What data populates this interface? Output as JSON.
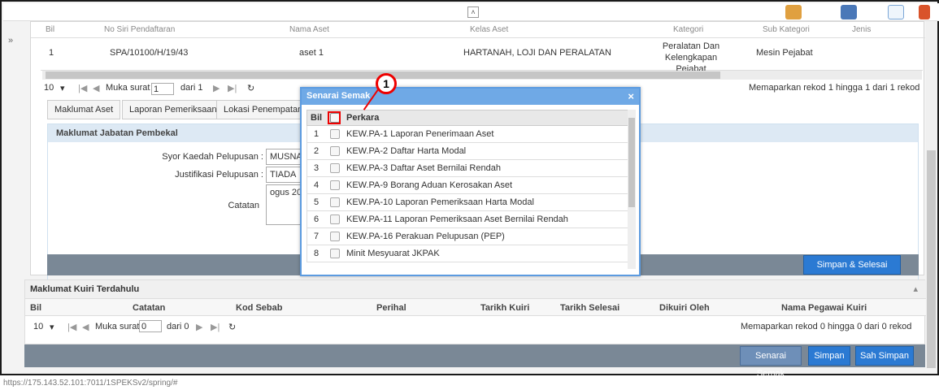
{
  "asset_table": {
    "headers": [
      "Bil",
      "No Siri Pendaftaran",
      "Nama Aset",
      "Kelas Aset",
      "Kategori",
      "Sub Kategori",
      "Jenis"
    ],
    "row": {
      "bil": "1",
      "no_siri": "SPA/10100/H/19/43",
      "nama": "aset 1",
      "kelas": "HARTANAH, LOJI DAN PERALATAN",
      "kategori": "Peralatan Dan Kelengkapan Pejabat",
      "sub_kategori": "Mesin Pejabat"
    }
  },
  "pager_top": {
    "size": "10",
    "muka_surat_label": "Muka surat",
    "page": "1",
    "dari_label": "dari 1",
    "summary": "Memaparkan rekod 1 hingga 1 dari 1 rekod"
  },
  "tabs": [
    "Maklumat Aset",
    "Laporan Pemeriksaan",
    "Lokasi Penempatan"
  ],
  "jabatan": {
    "header": "Maklumat Jabatan Pembekal",
    "syor_label": "Syor Kaedah Pelupusan :",
    "syor_value": "MUSNA",
    "justifikasi_label": "Justifikasi Pelupusan :",
    "justifikasi_value": "TIADA",
    "catatan_label": "Catatan",
    "catatan_value": "ogus 20",
    "save_button": "Simpan & Selesai"
  },
  "modal": {
    "title": "Senarai Semak",
    "col_bil": "Bil",
    "col_perkara": "Perkara",
    "rows": [
      {
        "bil": "1",
        "perkara": "KEW.PA-1 Laporan Penerimaan Aset"
      },
      {
        "bil": "2",
        "perkara": "KEW.PA-2 Daftar Harta Modal"
      },
      {
        "bil": "3",
        "perkara": "KEW.PA-3 Daftar Aset Bernilai Rendah"
      },
      {
        "bil": "4",
        "perkara": "KEW.PA-9 Borang Aduan Kerosakan Aset"
      },
      {
        "bil": "5",
        "perkara": "KEW.PA-10 Laporan Pemeriksaan Harta Modal"
      },
      {
        "bil": "6",
        "perkara": "KEW.PA-11 Laporan Pemeriksaan Aset Bernilai Rendah"
      },
      {
        "bil": "7",
        "perkara": "KEW.PA-16 Perakuan Pelupusan (PEP)"
      },
      {
        "bil": "8",
        "perkara": "Minit Mesyuarat JKPAK"
      }
    ],
    "callout": "1"
  },
  "kuiri": {
    "header": "Maklumat Kuiri Terdahulu",
    "columns": [
      "Bil",
      "Catatan",
      "Kod Sebab",
      "Perihal",
      "Tarikh Kuiri",
      "Tarikh Selesai",
      "Dikuiri Oleh",
      "Nama Pegawai Kuiri"
    ],
    "pager": {
      "size": "10",
      "muka_surat_label": "Muka surat",
      "page": "0",
      "dari_label": "dari 0",
      "summary": "Memaparkan rekod 0 hingga 0 dari 0 rekod"
    }
  },
  "bottom_buttons": {
    "senarai_semak": "Senarai Semak",
    "simpan": "Simpan",
    "sah_simpan": "Sah Simpan"
  },
  "status_url": "https://175.143.52.101:7011/1SPEKSv2/spring/#"
}
